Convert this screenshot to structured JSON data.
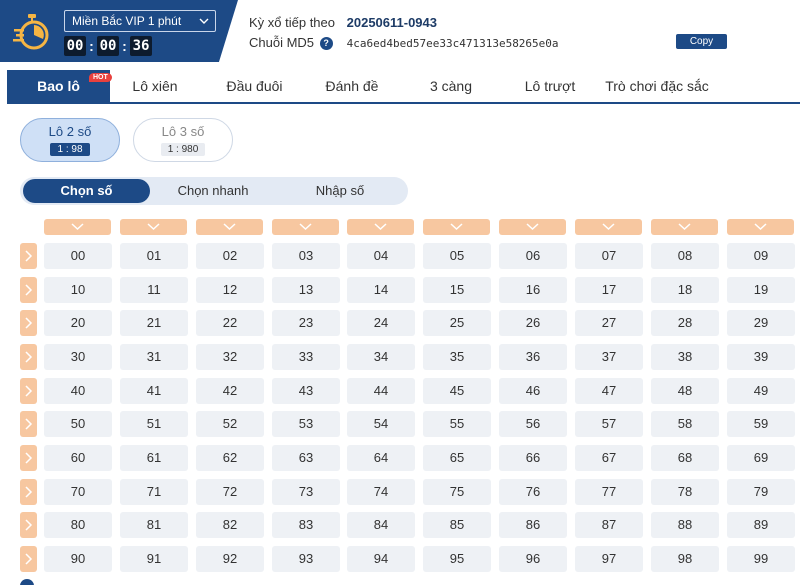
{
  "header": {
    "game_select": "Miền Bắc VIP 1 phút",
    "timer": [
      "00",
      "00",
      "36"
    ],
    "next_draw_label": "Kỳ xổ tiếp theo",
    "next_draw_value": "20250611-0943",
    "md5_label": "Chuỗi MD5",
    "md5_value": "4ca6ed4bed57ee33c471313e58265e0a",
    "copy_label": "Copy"
  },
  "tabs": [
    {
      "label": "Bao lô",
      "active": true,
      "badge": "HOT"
    },
    {
      "label": "Lô xiên"
    },
    {
      "label": "Đầu đuôi"
    },
    {
      "label": "Đánh đề"
    },
    {
      "label": "3 càng"
    },
    {
      "label": "Lô trượt"
    },
    {
      "label": "Trò chơi đặc sắc"
    }
  ],
  "subtypes": [
    {
      "name": "Lô 2 số",
      "odds": "1 : 98",
      "active": true
    },
    {
      "name": "Lô 3 số",
      "odds": "1 : 980",
      "active": false
    }
  ],
  "modes": [
    {
      "label": "Chọn số",
      "active": true
    },
    {
      "label": "Chọn nhanh"
    },
    {
      "label": "Nhập số"
    }
  ],
  "grid": {
    "rows": [
      [
        "00",
        "01",
        "02",
        "03",
        "04",
        "05",
        "06",
        "07",
        "08",
        "09"
      ],
      [
        "10",
        "11",
        "12",
        "13",
        "14",
        "15",
        "16",
        "17",
        "18",
        "19"
      ],
      [
        "20",
        "21",
        "22",
        "23",
        "24",
        "25",
        "26",
        "27",
        "28",
        "29"
      ],
      [
        "30",
        "31",
        "32",
        "33",
        "34",
        "35",
        "36",
        "37",
        "38",
        "39"
      ],
      [
        "40",
        "41",
        "42",
        "43",
        "44",
        "45",
        "46",
        "47",
        "48",
        "49"
      ],
      [
        "50",
        "51",
        "52",
        "53",
        "54",
        "55",
        "56",
        "57",
        "58",
        "59"
      ],
      [
        "60",
        "61",
        "62",
        "63",
        "64",
        "65",
        "66",
        "67",
        "68",
        "69"
      ],
      [
        "70",
        "71",
        "72",
        "73",
        "74",
        "75",
        "76",
        "77",
        "78",
        "79"
      ],
      [
        "80",
        "81",
        "82",
        "83",
        "84",
        "85",
        "86",
        "87",
        "88",
        "89"
      ],
      [
        "90",
        "91",
        "92",
        "93",
        "94",
        "95",
        "96",
        "97",
        "98",
        "99"
      ]
    ]
  },
  "colors": {
    "primary": "#1d4a86",
    "accent_orange": "#f7c7a0",
    "cell_bg": "#eef1f5",
    "hot_red": "#e8413e"
  },
  "icons": {
    "logo": "stopwatch-icon",
    "select": "chevron-down-icon",
    "help": "help-icon",
    "column_select": "chevron-down-icon",
    "row_select": "chevron-right-icon"
  }
}
